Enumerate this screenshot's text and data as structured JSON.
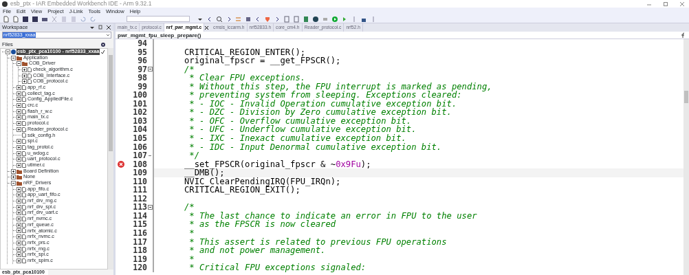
{
  "window": {
    "title": "esb_ptx - IAR Embedded Workbench IDE - Arm 9.32.1"
  },
  "menu": [
    "File",
    "Edit",
    "View",
    "Project",
    "J-Link",
    "Tools",
    "Window",
    "Help"
  ],
  "workspace": {
    "title": "Workspace",
    "configuration": "nrf52833_xxaa",
    "files_label": "Files",
    "bottom_tab": "esb_ptx_pca10100",
    "tree": [
      {
        "kind": "project",
        "label": "esb_ptx_pca10100 - nrf52833_xxaa",
        "selected": true,
        "expanded": true,
        "children": [
          {
            "kind": "group",
            "label": "Application",
            "selected": false,
            "expanded": true,
            "children": [
              {
                "kind": "group",
                "label": "COB_Driver",
                "selected": false,
                "expanded": true,
                "children": [
                  {
                    "kind": "file",
                    "label": "check_algorithm.c",
                    "selected": false,
                    "expanded": false
                  },
                  {
                    "kind": "file",
                    "label": "COB_Interface.c",
                    "selected": false,
                    "expanded": false
                  },
                  {
                    "kind": "file",
                    "label": "COB_protocol.c",
                    "selected": false,
                    "expanded": false
                  }
                ]
              },
              {
                "kind": "file",
                "label": "app_rf.c",
                "selected": false,
                "expanded": false
              },
              {
                "kind": "file",
                "label": "collect_tag.c",
                "selected": false,
                "expanded": false
              },
              {
                "kind": "file",
                "label": "Config_AppliedFile.c",
                "selected": false,
                "expanded": false
              },
              {
                "kind": "file",
                "label": "crc.c",
                "selected": false,
                "expanded": false
              },
              {
                "kind": "file",
                "label": "flash_r_w.c",
                "selected": false,
                "expanded": false
              },
              {
                "kind": "file",
                "label": "main_tx.c",
                "selected": false,
                "expanded": false
              },
              {
                "kind": "file",
                "label": "protocol.c",
                "selected": false,
                "expanded": false
              },
              {
                "kind": "file",
                "label": "Reader_protocol.c",
                "selected": false,
                "expanded": false
              },
              {
                "kind": "header",
                "label": "sdk_config.h",
                "selected": false
              },
              {
                "kind": "file",
                "label": "spi.c",
                "selected": false,
                "expanded": false
              },
              {
                "kind": "file",
                "label": "tag_protol.c",
                "selected": false,
                "expanded": false
              },
              {
                "kind": "file",
                "label": "u_wdog.c",
                "selected": false,
                "expanded": false
              },
              {
                "kind": "file",
                "label": "uart_protocol.c",
                "selected": false,
                "expanded": false
              },
              {
                "kind": "file",
                "label": "utimer.c",
                "selected": false,
                "expanded": false
              }
            ]
          },
          {
            "kind": "group",
            "label": "Board Definition",
            "selected": false,
            "expanded": false
          },
          {
            "kind": "group",
            "label": "None",
            "selected": false,
            "expanded": false
          },
          {
            "kind": "group",
            "label": "nRF_Drivers",
            "selected": false,
            "expanded": true,
            "children": [
              {
                "kind": "file",
                "label": "app_fifo.c",
                "selected": false,
                "expanded": false
              },
              {
                "kind": "file",
                "label": "app_uart_fifo.c",
                "selected": false,
                "expanded": false
              },
              {
                "kind": "file",
                "label": "nrf_drv_rng.c",
                "selected": false,
                "expanded": false
              },
              {
                "kind": "file",
                "label": "nrf_drv_spi.c",
                "selected": false,
                "expanded": false
              },
              {
                "kind": "file",
                "label": "nrf_drv_uart.c",
                "selected": false,
                "expanded": false
              },
              {
                "kind": "file",
                "label": "nrf_nvmc.c",
                "selected": false,
                "expanded": false
              },
              {
                "kind": "file",
                "label": "nrf_queue.c",
                "selected": false,
                "expanded": false
              },
              {
                "kind": "file",
                "label": "nrfx_atomic.c",
                "selected": false,
                "expanded": false
              },
              {
                "kind": "file",
                "label": "nrfx_nvmc.c",
                "selected": false,
                "expanded": false
              },
              {
                "kind": "file",
                "label": "nrfx_prs.c",
                "selected": false,
                "expanded": false
              },
              {
                "kind": "file",
                "label": "nrfx_rng.c",
                "selected": false,
                "expanded": false
              },
              {
                "kind": "file",
                "label": "nrfx_spi.c",
                "selected": false,
                "expanded": false
              },
              {
                "kind": "file",
                "label": "nrfx_spim.c",
                "selected": false,
                "expanded": false
              }
            ]
          }
        ]
      }
    ]
  },
  "editor": {
    "tabs": [
      {
        "label": "main_tx.c",
        "selected": false
      },
      {
        "label": "protocol.c",
        "selected": false
      },
      {
        "label": "nrf_pwr_mgmt.c",
        "selected": true
      },
      {
        "label": "cmsis_iccarm.h",
        "selected": false
      },
      {
        "label": "nrf52833.h",
        "selected": false
      },
      {
        "label": "core_cm4.h",
        "selected": false
      },
      {
        "label": "Reader_protocol.c",
        "selected": false
      },
      {
        "label": "nrf52.h",
        "selected": false
      }
    ],
    "function": "pwr_mgmt_fpu_sleep_prepare()",
    "lines": [
      {
        "number": "94",
        "current": false
      },
      {
        "number": "95",
        "current": false,
        "segments": [
          {
            "kind": "code",
            "text": "CRITICAL_REGION_ENTER();"
          }
        ]
      },
      {
        "number": "96",
        "current": false,
        "segments": [
          {
            "kind": "code",
            "text": "original_fpscr = __get_FPSCR();"
          }
        ]
      },
      {
        "number": "97",
        "current": false,
        "foldable": true,
        "segments": [
          {
            "kind": "comment",
            "text": "/*"
          }
        ]
      },
      {
        "number": "98",
        "current": false,
        "segments": [
          {
            "kind": "comment",
            "text": " * Clear FPU exceptions."
          }
        ]
      },
      {
        "number": "99",
        "current": false,
        "segments": [
          {
            "kind": "comment",
            "text": " * Without this step, the FPU interrupt is marked as pending,"
          }
        ]
      },
      {
        "number": "100",
        "current": false,
        "segments": [
          {
            "kind": "comment",
            "text": " * preventing system from sleeping. Exceptions cleared:"
          }
        ]
      },
      {
        "number": "101",
        "current": false,
        "segments": [
          {
            "kind": "comment",
            "text": " * - IOC - Invalid Operation cumulative exception bit."
          }
        ]
      },
      {
        "number": "102",
        "current": false,
        "segments": [
          {
            "kind": "comment",
            "text": " * - DZC - Division by Zero cumulative exception bit."
          }
        ]
      },
      {
        "number": "103",
        "current": false,
        "segments": [
          {
            "kind": "comment",
            "text": " * - OFC - Overflow cumulative exception bit."
          }
        ]
      },
      {
        "number": "104",
        "current": false,
        "segments": [
          {
            "kind": "comment",
            "text": " * - UFC - Underflow cumulative exception bit."
          }
        ]
      },
      {
        "number": "105",
        "current": false,
        "segments": [
          {
            "kind": "comment",
            "text": " * - IXC - Inexact cumulative exception bit."
          }
        ]
      },
      {
        "number": "106",
        "current": false,
        "segments": [
          {
            "kind": "comment",
            "text": " * - IDC - Input Denormal cumulative exception bit."
          }
        ]
      },
      {
        "number": "107",
        "current": false,
        "fold_end": true,
        "segments": [
          {
            "kind": "comment",
            "text": " */"
          }
        ]
      },
      {
        "number": "108",
        "current": false,
        "error": true,
        "segments": [
          {
            "kind": "code",
            "text": "__set_FPSCR(original_fpscr & ~"
          },
          {
            "kind": "number",
            "text": "0x9Fu"
          },
          {
            "kind": "code",
            "text": ");"
          }
        ]
      },
      {
        "number": "109",
        "current": true,
        "segments": [
          {
            "kind": "code",
            "text": "__DMB();"
          }
        ]
      },
      {
        "number": "110",
        "current": false,
        "segments": [
          {
            "kind": "code",
            "text": "NVIC_ClearPendingIRQ(FPU_IRQn);"
          }
        ]
      },
      {
        "number": "111",
        "current": false,
        "segments": [
          {
            "kind": "code",
            "text": "CRITICAL_REGION_EXIT();"
          }
        ]
      },
      {
        "number": "112",
        "current": false
      },
      {
        "number": "113",
        "current": false,
        "foldable": true,
        "segments": [
          {
            "kind": "comment",
            "text": "/*"
          }
        ]
      },
      {
        "number": "114",
        "current": false,
        "segments": [
          {
            "kind": "comment",
            "text": " * The last chance to indicate an error in FPU to the user"
          }
        ]
      },
      {
        "number": "115",
        "current": false,
        "segments": [
          {
            "kind": "comment",
            "text": " * as the FPSCR is now cleared"
          }
        ]
      },
      {
        "number": "116",
        "current": false,
        "segments": [
          {
            "kind": "comment",
            "text": " *"
          }
        ]
      },
      {
        "number": "117",
        "current": false,
        "segments": [
          {
            "kind": "comment",
            "text": " * This assert is related to previous FPU operations"
          }
        ]
      },
      {
        "number": "118",
        "current": false,
        "segments": [
          {
            "kind": "comment",
            "text": " * and not power management."
          }
        ]
      },
      {
        "number": "119",
        "current": false,
        "segments": [
          {
            "kind": "comment",
            "text": " *"
          }
        ]
      },
      {
        "number": "120",
        "current": false,
        "segments": [
          {
            "kind": "comment",
            "text": " * Critical FPU exceptions signaled:"
          }
        ]
      }
    ]
  }
}
